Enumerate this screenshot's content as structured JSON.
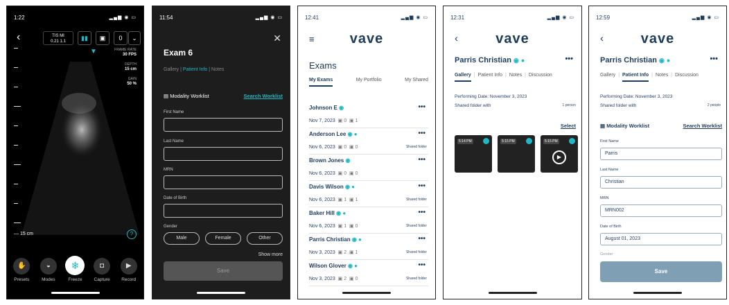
{
  "p1": {
    "time": "1:22",
    "tis": "TIS",
    "tis_v": "0.21",
    "mi": "MI",
    "mi_v": "1.1",
    "zero_label": "0",
    "frame_rate_label": "FRAME RATE",
    "frame_rate": "30 FPS",
    "depth_label": "DEPTH",
    "depth": "15 cm",
    "gain_label": "GAIN",
    "gain": "50 %",
    "depth_marker": "15 cm",
    "help": "?",
    "tools": [
      "Presets",
      "Modes",
      "Freeze",
      "Capture",
      "Record"
    ]
  },
  "p2": {
    "time": "11:54",
    "title": "Exam 6",
    "tabs": [
      "Gallery",
      "Patient Info",
      "Notes"
    ],
    "worklist": "Modality Worklist",
    "search": "Search Worklist",
    "fields": [
      "First Name",
      "Last Name",
      "MRN",
      "Date of Birth"
    ],
    "gender_label": "Gender",
    "genders": [
      "Male",
      "Female",
      "Other"
    ],
    "show_more": "Show more",
    "save": "Save"
  },
  "p3": {
    "time": "12:41",
    "logo": "vave",
    "title": "Exams",
    "tabs": [
      "My Exams",
      "My Portfolio",
      "My Shared"
    ],
    "exams": [
      {
        "name": "Johnson E",
        "date": "Nov 7, 2023",
        "a": "0",
        "b": "1",
        "shared": ""
      },
      {
        "name": "Anderson Lee",
        "date": "Nov 6, 2023",
        "a": "0",
        "b": "0",
        "shared": "Shared folder"
      },
      {
        "name": "Brown Jones",
        "date": "Nov 6, 2023",
        "a": "0",
        "b": "0",
        "shared": ""
      },
      {
        "name": "Davis Wilson",
        "date": "Nov 6, 2023",
        "a": "1",
        "b": "1",
        "shared": "Shared folder"
      },
      {
        "name": "Baker Hill",
        "date": "Nov 6, 2023",
        "a": "1",
        "b": "0",
        "shared": "Shared folder"
      },
      {
        "name": "Parris Christian",
        "date": "Nov 3, 2023",
        "a": "2",
        "b": "1",
        "shared": "Shared folder"
      },
      {
        "name": "Wilson Glover",
        "date": "Nov 3, 2023",
        "a": "2",
        "b": "0",
        "shared": "Shared folder"
      }
    ]
  },
  "p4": {
    "time": "12:31",
    "logo": "vave",
    "name": "Parris Christian",
    "tabs": [
      "Gallery",
      "Patient Info",
      "Notes",
      "Discussion"
    ],
    "performing": "Performing Date: November 3, 2023",
    "shared": "Shared folder with",
    "shared_count": "1 person",
    "select": "Select",
    "thumbs": [
      "5:14 PM",
      "5:15 PM",
      "5:15 PM"
    ]
  },
  "p5": {
    "time": "12:59",
    "logo": "vave",
    "name": "Parris Christian",
    "tabs": [
      "Gallery",
      "Patient Info",
      "Notes",
      "Discussion"
    ],
    "performing": "Performing Date: November 3, 2023",
    "shared": "Shared folder with",
    "shared_count": "2 people",
    "worklist": "Modality Worklist",
    "search": "Search Worklist",
    "fields": [
      {
        "label": "First Name",
        "value": "Parris"
      },
      {
        "label": "Last Name",
        "value": "Christian"
      },
      {
        "label": "MRN",
        "value": "MRN002"
      },
      {
        "label": "Date of Birth",
        "value": "August 01, 2023"
      }
    ],
    "gender_label": "Gender",
    "save": "Save"
  },
  "colors": {
    "accent": "#1fb8c4",
    "navy": "#1d3b5c"
  }
}
